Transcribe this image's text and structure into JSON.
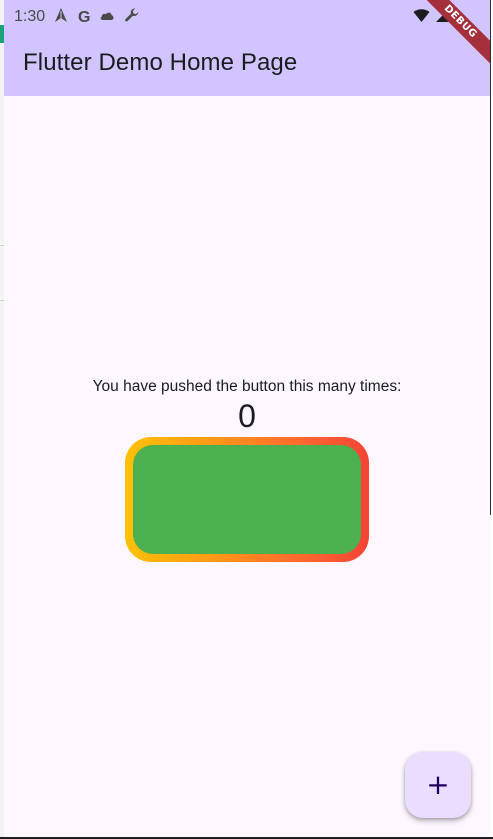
{
  "status_bar": {
    "time": "1:30",
    "left_icons": [
      "navigation-icon",
      "google-icon",
      "cloud-icon",
      "wrench-icon"
    ],
    "right_icons": [
      "wifi-icon",
      "signal-icon"
    ],
    "google_letter": "G"
  },
  "app_bar": {
    "title": "Flutter Demo Home Page",
    "color": "#d2c4ff"
  },
  "debug_banner": {
    "label": "DEBUG",
    "color": "#a5303b"
  },
  "main": {
    "prompt": "You have pushed the button this many times:",
    "counter": "0",
    "box": {
      "gradient_colors": [
        "#ffc107",
        "#f44336"
      ],
      "fill_color": "#4caf50"
    }
  },
  "fab": {
    "icon": "add-icon",
    "glyph": "+",
    "color": "#eaddff"
  }
}
